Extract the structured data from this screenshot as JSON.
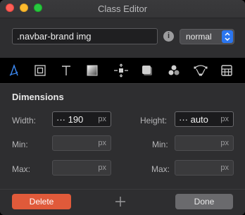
{
  "window": {
    "title": "Class Editor"
  },
  "selector": {
    "value": ".navbar-brand img"
  },
  "state": {
    "selected": "normal"
  },
  "toolbar": {
    "tools": [
      "typography-icon",
      "box-model-icon",
      "text-icon",
      "background-icon",
      "dimensions-icon",
      "shadow-icon",
      "effects-icon",
      "transform-icon",
      "grid-icon"
    ]
  },
  "dimensions": {
    "title": "Dimensions",
    "width": {
      "label": "Width:",
      "value": "··· 190",
      "unit": "px"
    },
    "height": {
      "label": "Height:",
      "value": "··· auto",
      "unit": "px"
    },
    "min_left": {
      "label": "Min:",
      "value": "",
      "unit": "px"
    },
    "min_right": {
      "label": "Min:",
      "value": "",
      "unit": "px"
    },
    "max_left": {
      "label": "Max:",
      "value": "",
      "unit": "px"
    },
    "max_right": {
      "label": "Max:",
      "value": "",
      "unit": "px"
    }
  },
  "footer": {
    "delete_label": "Delete",
    "done_label": "Done"
  },
  "colors": {
    "accent": "#2b76f0",
    "delete": "#e05a3a",
    "active_tool": "#3d8bf5"
  }
}
